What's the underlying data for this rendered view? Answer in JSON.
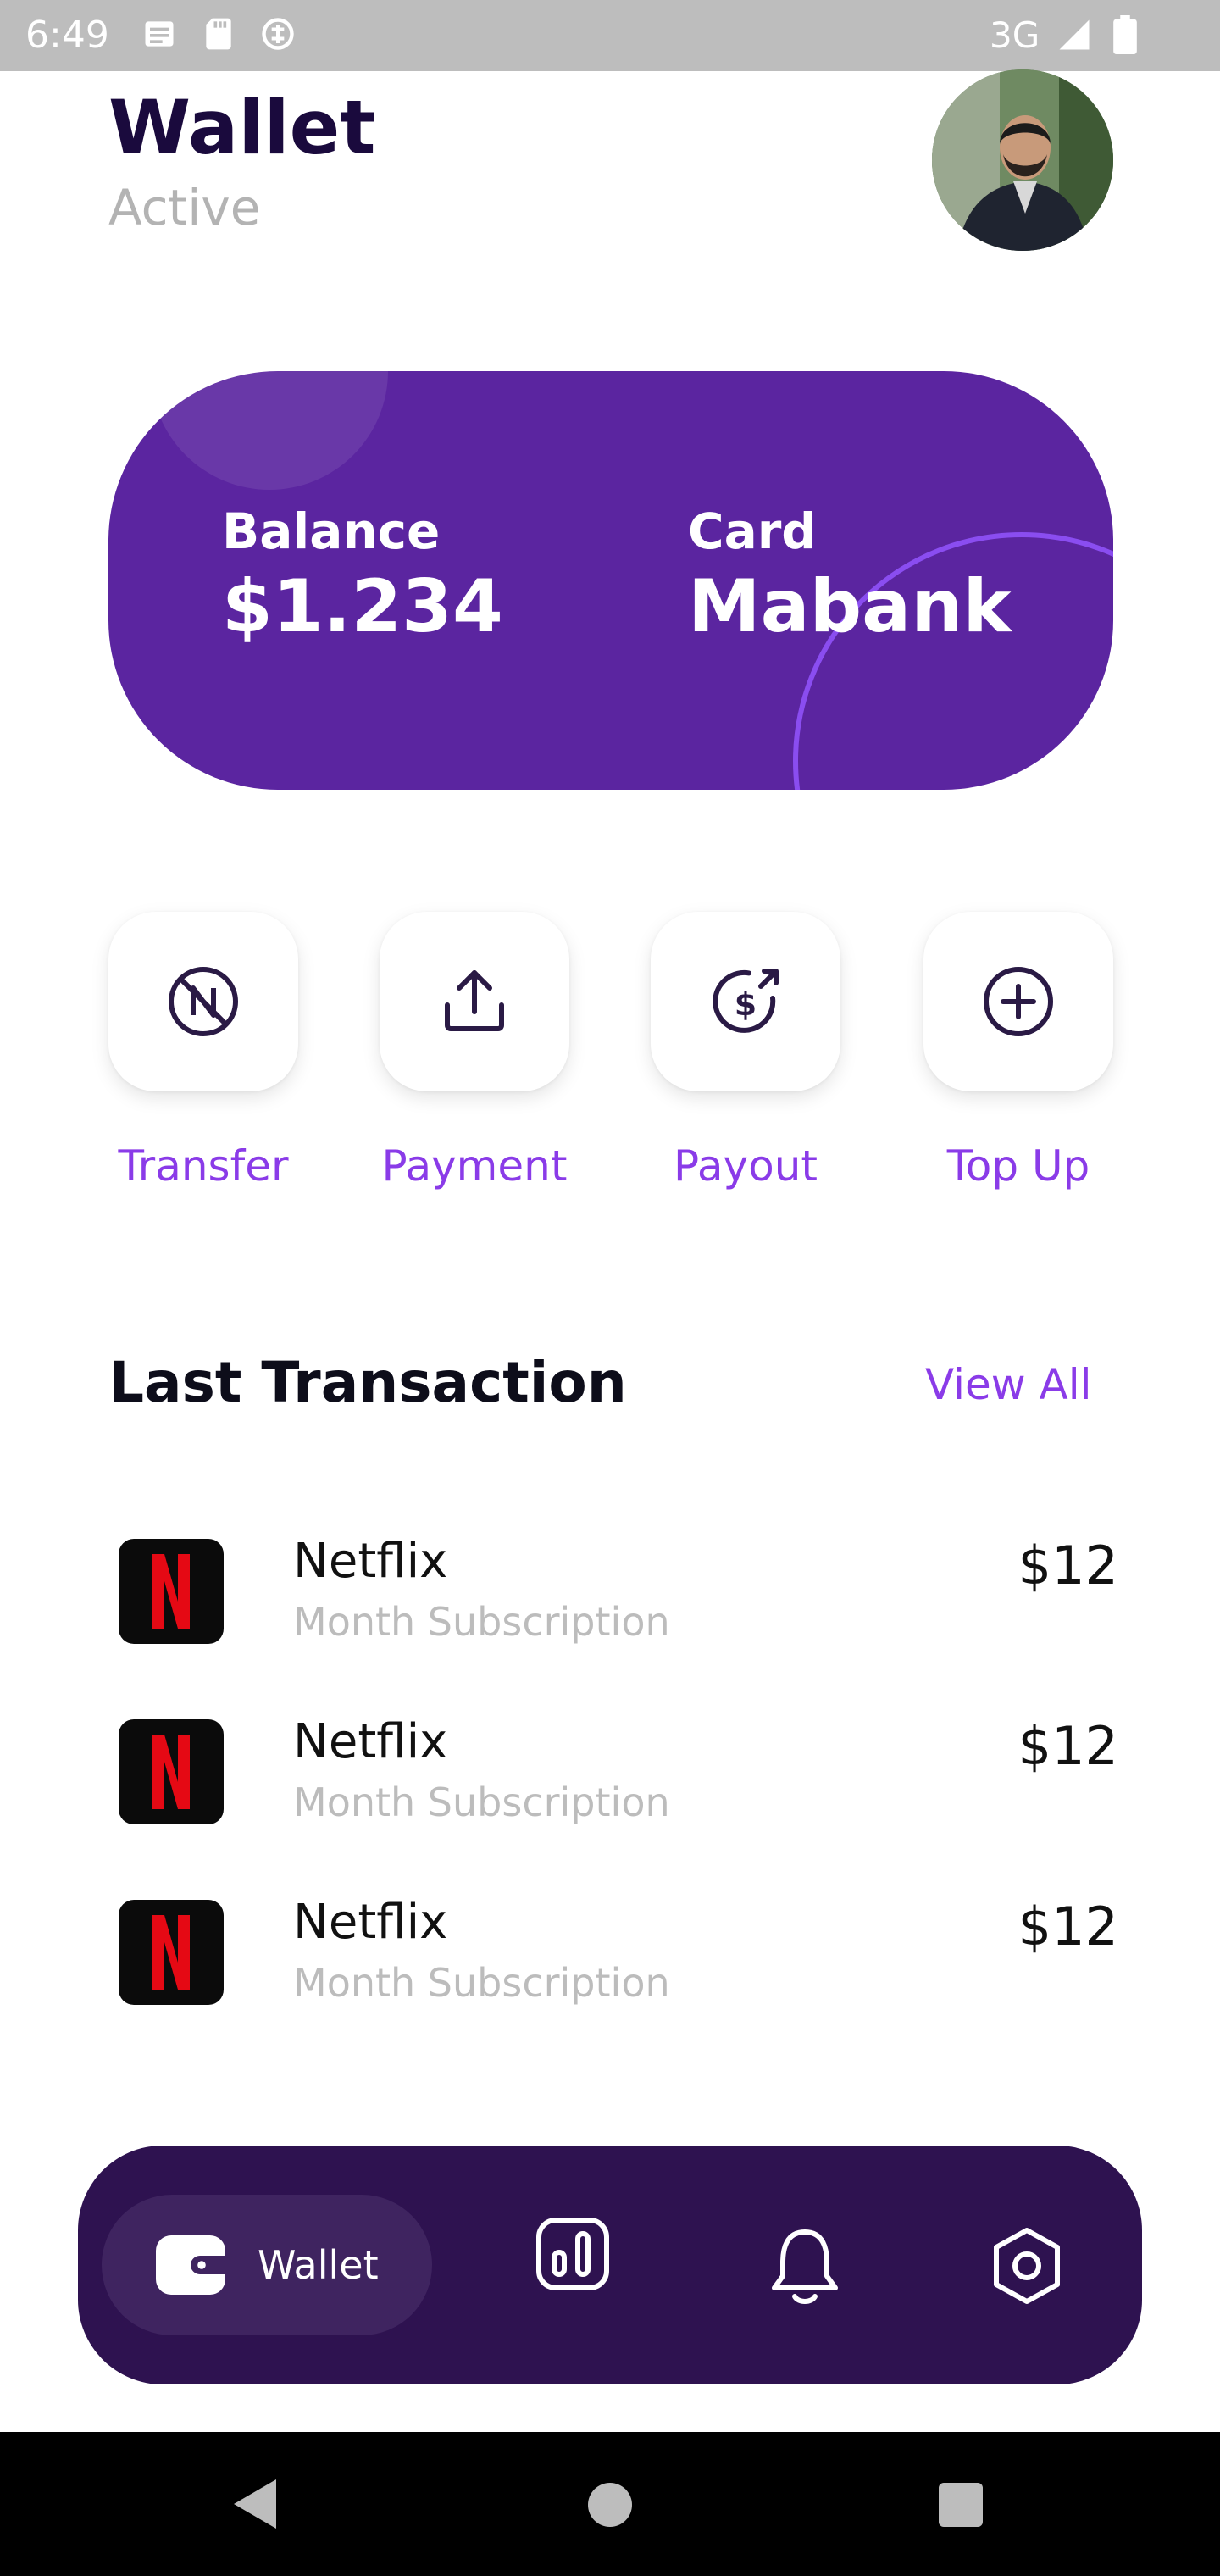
{
  "status_bar": {
    "time": "6:49",
    "network": "3G",
    "left_icons": [
      "news-icon",
      "sd-card-icon",
      "vpn-icon"
    ],
    "right_icons": [
      "signal-icon",
      "battery-icon"
    ]
  },
  "header": {
    "title": "Wallet",
    "subtitle": "Active",
    "avatar": "user-avatar"
  },
  "card": {
    "balance_label": "Balance",
    "balance_value": "$1.234",
    "card_label": "Card",
    "card_value": "Mabank",
    "color": "#5b25a0"
  },
  "actions": [
    {
      "label": "Transfer",
      "icon": "no-transfer-icon"
    },
    {
      "label": "Payment",
      "icon": "upload-icon"
    },
    {
      "label": "Payout",
      "icon": "dollar-payout-icon"
    },
    {
      "label": "Top Up",
      "icon": "plus-circle-icon"
    }
  ],
  "transactions_section": {
    "title": "Last Transaction",
    "view_all": "View All"
  },
  "transactions": [
    {
      "name": "Netflix",
      "subtitle": "Month Subscription",
      "amount": "$12",
      "icon": "netflix-logo"
    },
    {
      "name": "Netflix",
      "subtitle": "Month Subscription",
      "amount": "$12",
      "icon": "netflix-logo"
    },
    {
      "name": "Netflix",
      "subtitle": "Month Subscription",
      "amount": "$12",
      "icon": "netflix-logo"
    }
  ],
  "bottom_nav": {
    "active_label": "Wallet",
    "items": [
      "wallet-icon",
      "stats-icon",
      "bell-icon",
      "settings-icon"
    ],
    "color": "#2e1250"
  },
  "accent_color": "#8a3be8"
}
